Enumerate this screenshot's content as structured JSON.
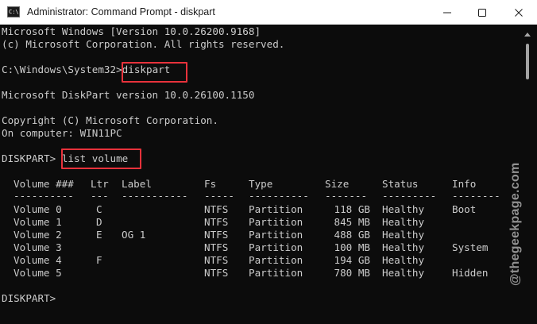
{
  "window": {
    "title": "Administrator: Command Prompt - diskpart",
    "icon_label": "C:\\.",
    "icon": "terminal-icon"
  },
  "controls": {
    "minimize": "minimize-icon",
    "maximize": "maximize-icon",
    "close": "close-icon"
  },
  "console": {
    "lines": [
      "Microsoft Windows [Version 10.0.26200.9168]",
      "(c) Microsoft Corporation. All rights reserved.",
      "",
      "C:\\Windows\\System32>diskpart",
      "",
      "Microsoft DiskPart version 10.0.26100.1150",
      "",
      "Copyright (C) Microsoft Corporation.",
      "On computer: WIN11PC",
      "",
      "DISKPART> list volume"
    ],
    "prompt_path": "C:\\Windows\\System32>",
    "command1": "diskpart",
    "diskpart_prompt": "DISKPART>",
    "command2": "list volume",
    "final_prompt": "DISKPART>"
  },
  "table": {
    "headers": {
      "volume": "Volume ###",
      "ltr": "Ltr",
      "label": "Label",
      "fs": "Fs",
      "type": "Type",
      "size": "Size",
      "status": "Status",
      "info": "Info"
    },
    "separators": {
      "volume": "----------",
      "ltr": "---",
      "label": "-----------",
      "fs": "-----",
      "type": "----------",
      "size": "-------",
      "status": "---------",
      "info": "--------"
    },
    "rows": [
      {
        "volume": "Volume 0",
        "ltr": "C",
        "label": "",
        "fs": "NTFS",
        "type": "Partition",
        "size": "118 GB",
        "status": "Healthy",
        "info": "Boot"
      },
      {
        "volume": "Volume 1",
        "ltr": "D",
        "label": "",
        "fs": "NTFS",
        "type": "Partition",
        "size": "845 MB",
        "status": "Healthy",
        "info": ""
      },
      {
        "volume": "Volume 2",
        "ltr": "E",
        "label": "OG 1",
        "fs": "NTFS",
        "type": "Partition",
        "size": "488 GB",
        "status": "Healthy",
        "info": ""
      },
      {
        "volume": "Volume 3",
        "ltr": "",
        "label": "",
        "fs": "NTFS",
        "type": "Partition",
        "size": "100 MB",
        "status": "Healthy",
        "info": "System"
      },
      {
        "volume": "Volume 4",
        "ltr": "F",
        "label": "",
        "fs": "NTFS",
        "type": "Partition",
        "size": "194 GB",
        "status": "Healthy",
        "info": ""
      },
      {
        "volume": "Volume 5",
        "ltr": "",
        "label": "",
        "fs": "NTFS",
        "type": "Partition",
        "size": "780 MB",
        "status": "Healthy",
        "info": "Hidden"
      }
    ]
  },
  "watermark": "@thegeekpage.com",
  "colors": {
    "background": "#0c0c0c",
    "text": "#cccccc",
    "highlight": "#e8323b",
    "titlebar": "#ffffff"
  }
}
